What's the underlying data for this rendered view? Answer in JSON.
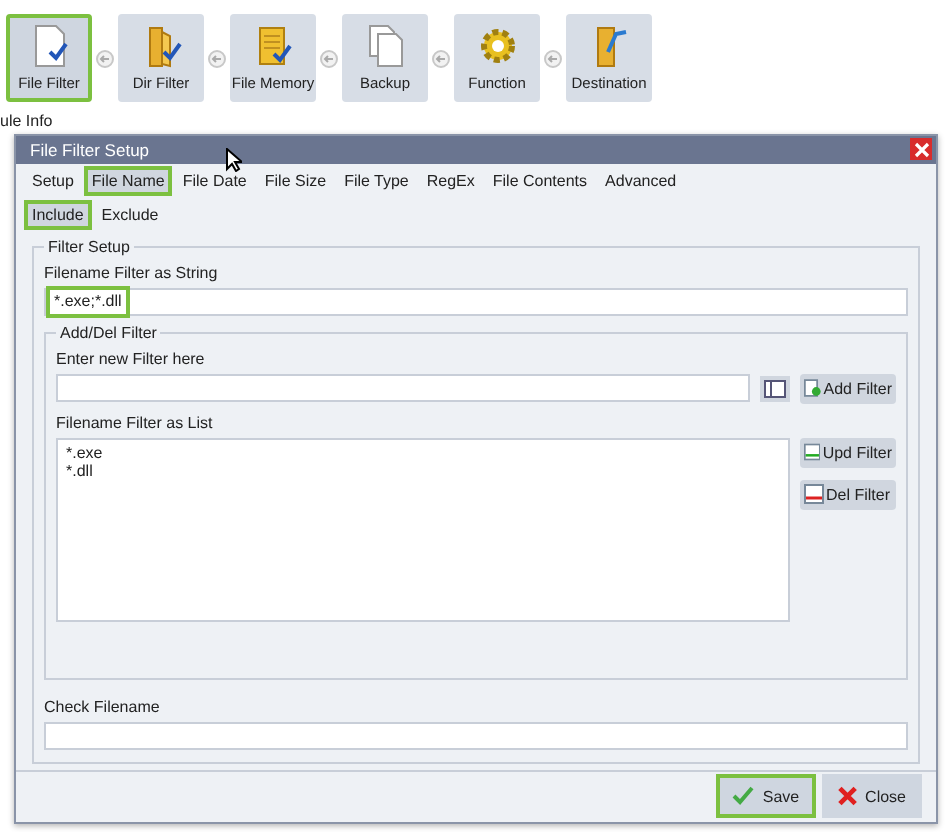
{
  "toolbar": [
    {
      "label": "File Filter",
      "kind": "doc",
      "highlighted": true
    },
    {
      "label": "Dir Filter",
      "kind": "folder",
      "highlighted": false
    },
    {
      "label": "File Memory",
      "kind": "memory",
      "highlighted": false
    },
    {
      "label": "Backup",
      "kind": "copy",
      "highlighted": false
    },
    {
      "label": "Function",
      "kind": "gear",
      "highlighted": false
    },
    {
      "label": "Destination",
      "kind": "dest",
      "highlighted": false
    }
  ],
  "background_label": "ule Info",
  "dialog": {
    "title": "File Filter Setup",
    "tabs": [
      {
        "label": "Setup",
        "selected": false
      },
      {
        "label": "File Name",
        "selected": true
      },
      {
        "label": "File Date",
        "selected": false
      },
      {
        "label": "File Size",
        "selected": false
      },
      {
        "label": "File Type",
        "selected": false
      },
      {
        "label": "RegEx",
        "selected": false
      },
      {
        "label": "File Contents",
        "selected": false
      },
      {
        "label": "Advanced",
        "selected": false
      }
    ],
    "subtabs": [
      {
        "label": "Include",
        "selected": true
      },
      {
        "label": "Exclude",
        "selected": false
      }
    ],
    "filter_setup": {
      "title": "Filter Setup",
      "string_label": "Filename Filter as String",
      "string_value": "*.exe;*.dll",
      "string_highlighted": true,
      "add_del": {
        "title": "Add/Del Filter",
        "new_label": "Enter new Filter here",
        "add_button": "Add Filter",
        "list_label": "Filename Filter as List",
        "list_items": [
          "*.exe",
          "*.dll"
        ],
        "upd_button": "Upd Filter",
        "del_button": "Del Filter"
      },
      "check_label": "Check Filename"
    },
    "buttons": [
      {
        "label": "Save",
        "kind": "save",
        "highlighted": true
      },
      {
        "label": "Close",
        "kind": "close",
        "highlighted": false
      }
    ]
  }
}
